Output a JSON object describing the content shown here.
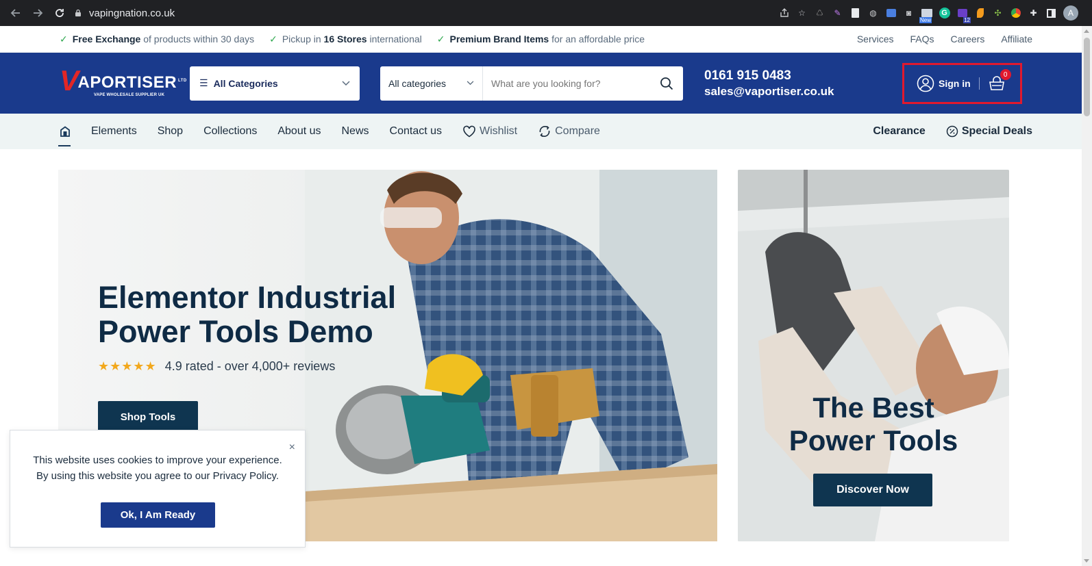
{
  "browser": {
    "url": "vapingnation.co.uk",
    "profile_initial": "A",
    "ext_badge_new": "New",
    "ext_badge_count": "12"
  },
  "topbar": {
    "perks": [
      {
        "bold": "Free Exchange",
        "text": " of products within 30 days"
      },
      {
        "pre": "Pickup in ",
        "bold": "16 Stores",
        "text": " international"
      },
      {
        "bold": "Premium Brand Items",
        "text": " for an affordable price"
      }
    ],
    "links": [
      "Services",
      "FAQs",
      "Careers",
      "Affiliate"
    ]
  },
  "header": {
    "logo_letter": "V",
    "logo_word": "APORTISER",
    "logo_ltd": "LTD",
    "logo_tagline": "VAPE WHOLESALE SUPPLIER UK",
    "all_categories": "All Categories",
    "search_category": "All categories",
    "search_placeholder": "What are you looking for?",
    "phone": "0161 915 0483",
    "email": "sales@vaportiser.co.uk",
    "sign_in": "Sign in",
    "cart_count": "0"
  },
  "nav": {
    "items": [
      "Elements",
      "Shop",
      "Collections",
      "About us",
      "News",
      "Contact us"
    ],
    "wishlist": "Wishlist",
    "compare": "Compare",
    "clearance": "Clearance",
    "special_deals": "Special Deals"
  },
  "hero": {
    "title_line1": "Elementor Industrial",
    "title_line2": "Power Tools Demo",
    "stars": "★★★★★",
    "rating_text": "4.9 rated - over 4,000+ reviews",
    "rating_value": 4.9,
    "cta": "Shop Tools"
  },
  "side_banner": {
    "title_line1": "The Best",
    "title_line2": "Power Tools",
    "cta": "Discover Now"
  },
  "cookie": {
    "line1": "This website uses cookies to improve your experience.",
    "line2": "By using this website you agree to our Privacy Policy.",
    "button": "Ok, I Am Ready",
    "close": "×"
  },
  "colors": {
    "header_bg": "#1a3a8c",
    "nav_bg": "#eef4f4",
    "button_dark": "#0f3550",
    "highlight_border": "#e0192e",
    "accent_red": "#e32626",
    "check_green": "#2fa84f",
    "star_gold": "#f2a81d"
  }
}
